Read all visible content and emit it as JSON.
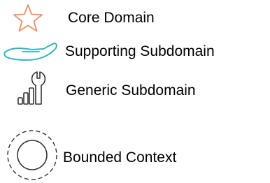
{
  "legend": {
    "items": [
      {
        "label": "Core Domain",
        "icon": "star-icon",
        "color": "#E8906B"
      },
      {
        "label": "Supporting Subdomain",
        "icon": "hand-icon",
        "color": "#2FB5BE"
      },
      {
        "label": "Generic Subdomain",
        "icon": "wrench-signal-icon",
        "color": "#333333"
      },
      {
        "label": "Bounded Context",
        "icon": "dashed-circle-icon",
        "color": "#333333"
      }
    ]
  }
}
